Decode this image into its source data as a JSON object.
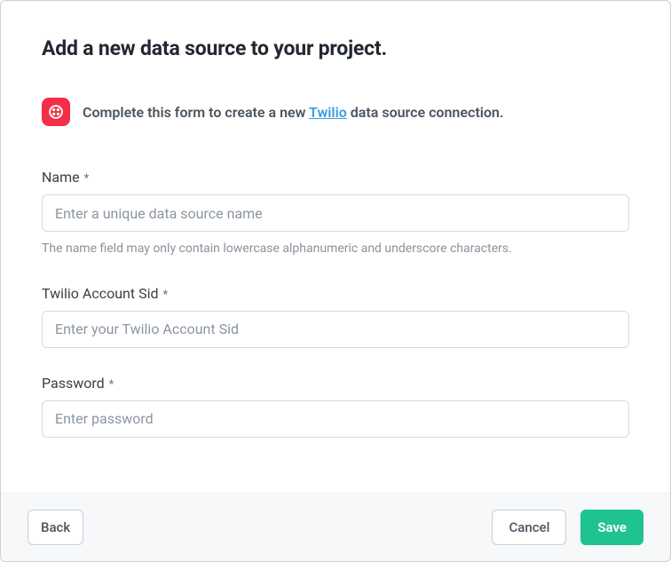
{
  "header": {
    "title": "Add a new data source to your project."
  },
  "info": {
    "prefix": "Complete this form to create a new ",
    "brand": "Twilio",
    "suffix": " data source connection."
  },
  "fields": {
    "name": {
      "label": "Name",
      "required": "*",
      "placeholder": "Enter a unique data source name",
      "help": "The name field may only contain lowercase alphanumeric and underscore characters."
    },
    "sid": {
      "label": "Twilio Account Sid",
      "required": "*",
      "placeholder": "Enter your Twilio Account Sid"
    },
    "password": {
      "label": "Password",
      "required": "*",
      "placeholder": "Enter password"
    }
  },
  "footer": {
    "back": "Back",
    "cancel": "Cancel",
    "save": "Save"
  }
}
